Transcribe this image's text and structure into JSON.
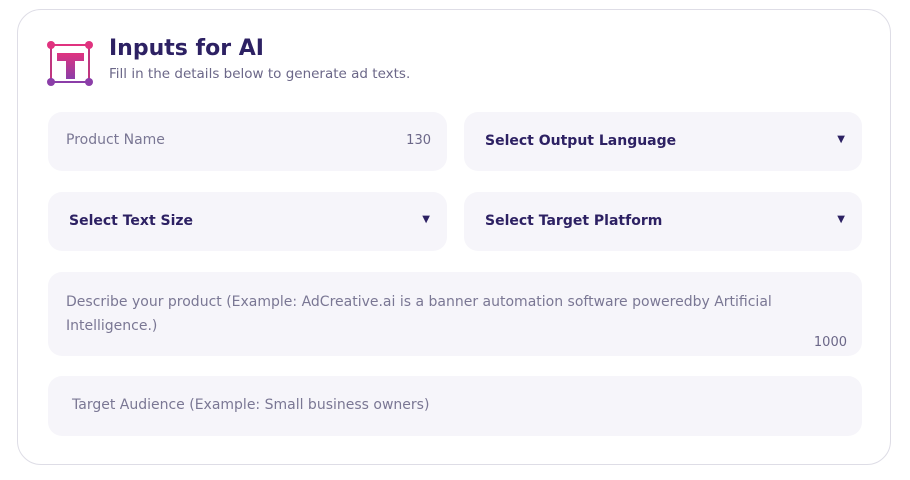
{
  "header": {
    "title": "Inputs for AI",
    "subtitle": "Fill in the details below to generate ad texts.",
    "icon": "text-frame-icon",
    "icon_colors": [
      "#e0337f",
      "#8b3ea8"
    ]
  },
  "fields": {
    "product_name": {
      "placeholder": "Product Name",
      "counter": "130"
    },
    "output_language": {
      "label": "Select Output Language"
    },
    "text_size": {
      "label": "Select Text Size"
    },
    "target_platform": {
      "label": "Select Target Platform"
    },
    "description": {
      "placeholder": "Describe your product (Example: AdCreative.ai is a banner automation software poweredby Artificial Intelligence.)",
      "counter": "1000"
    },
    "target_audience": {
      "placeholder": "Target Audience (Example: Small business owners)"
    }
  },
  "dropdown_caret": "▼",
  "colors": {
    "text_primary": "#2d2163",
    "text_muted": "#7a7794",
    "field_bg": "#f6f5fa",
    "card_border": "#dedde6"
  }
}
